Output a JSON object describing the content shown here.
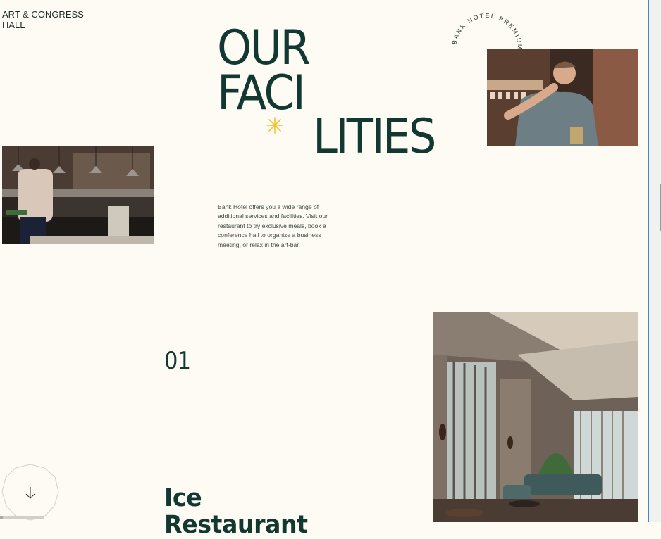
{
  "nav": {
    "top_link": "ART & CONGRESS HALL"
  },
  "hero": {
    "title_line1": "OUR",
    "title_line2": "FACI",
    "title_line3": "LITIES",
    "star_color": "#f2c230",
    "intro": "Bank Hotel offers you a wide range of additional services and facilities. Visit our restaurant to try exclusive meals, book a conference hall to organize a business meeting, or relax in the art-bar."
  },
  "badge": {
    "circle_text": "BANK HOTEL PREMIUM ROOM"
  },
  "section": {
    "number": "01",
    "title_line1": "Ice",
    "title_line2": "Restaurant"
  },
  "controls": {
    "scroll_icon": "arrow-down-icon",
    "progress": 0.07
  },
  "colors": {
    "background": "#fdfbf3",
    "text": "#123832",
    "accent": "#f2c230"
  }
}
